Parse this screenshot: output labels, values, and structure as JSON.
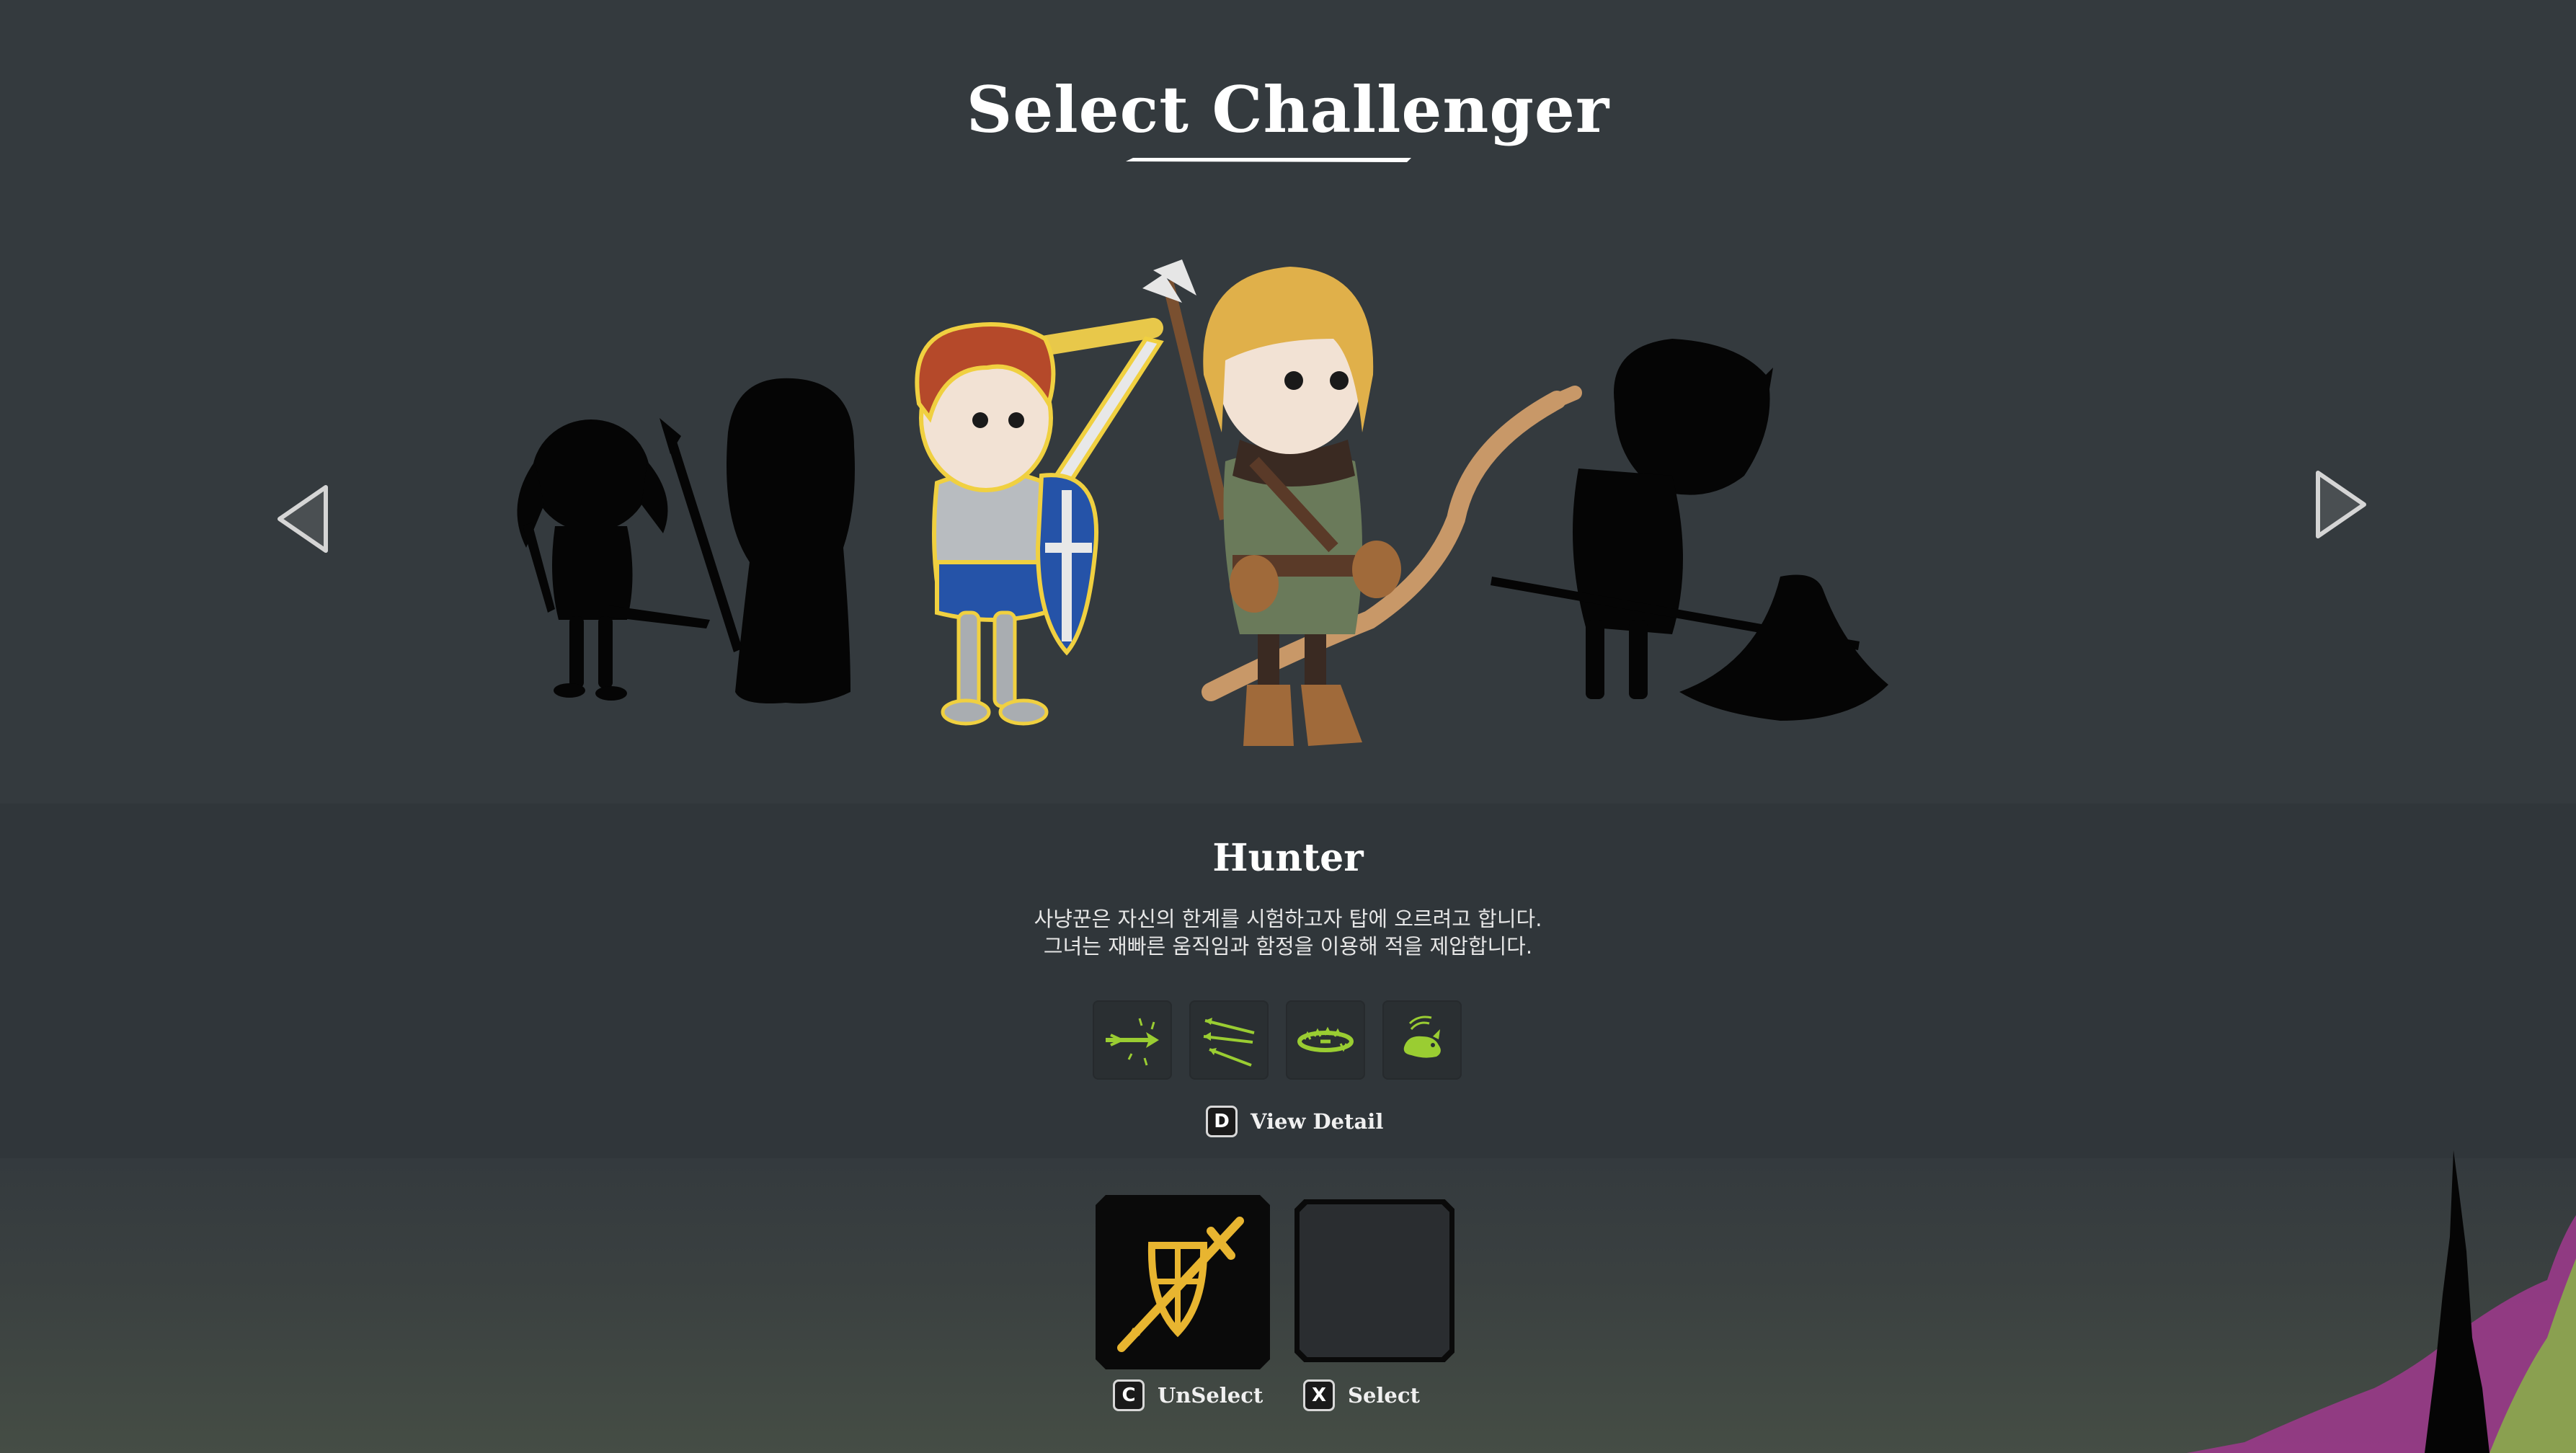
{
  "screen": {
    "title": "Select Challenger"
  },
  "navigation": {
    "prev_icon": "triangle-left-icon",
    "next_icon": "triangle-right-icon"
  },
  "characters": [
    {
      "id": "rogue-girl",
      "state": "locked-silhouette"
    },
    {
      "id": "hooded-spearman",
      "state": "locked-silhouette"
    },
    {
      "id": "knight",
      "state": "selected-highlighted"
    },
    {
      "id": "hunter",
      "state": "focused"
    },
    {
      "id": "axe-warrior",
      "state": "locked-silhouette"
    }
  ],
  "info": {
    "name": "Hunter",
    "description_line1": "사냥꾼은 자신의 한계를 시험하고자 탑에 오르려고 합니다.",
    "description_line2": "그녀는 재빠른 움직임과 함정을 이용해 적을 제압합니다.",
    "skills": [
      {
        "icon": "piercing-arrow-icon"
      },
      {
        "icon": "multi-arrow-icon"
      },
      {
        "icon": "spike-trap-icon"
      },
      {
        "icon": "beast-companion-icon"
      }
    ],
    "detail_key": "D",
    "detail_label": "View Detail"
  },
  "party": {
    "slots": [
      {
        "filled": true,
        "icon": "shield-sword-icon"
      },
      {
        "filled": false
      }
    ],
    "unselect_key": "C",
    "unselect_label": "UnSelect",
    "select_key": "X",
    "select_label": "Select"
  },
  "colors": {
    "background": "#343a3e",
    "accent_gold": "#e8b530",
    "skill_green": "#9acd32",
    "hunter_hair": "#e0b04a",
    "knight_hair": "#b5492a",
    "shield_blue": "#2553a8"
  }
}
